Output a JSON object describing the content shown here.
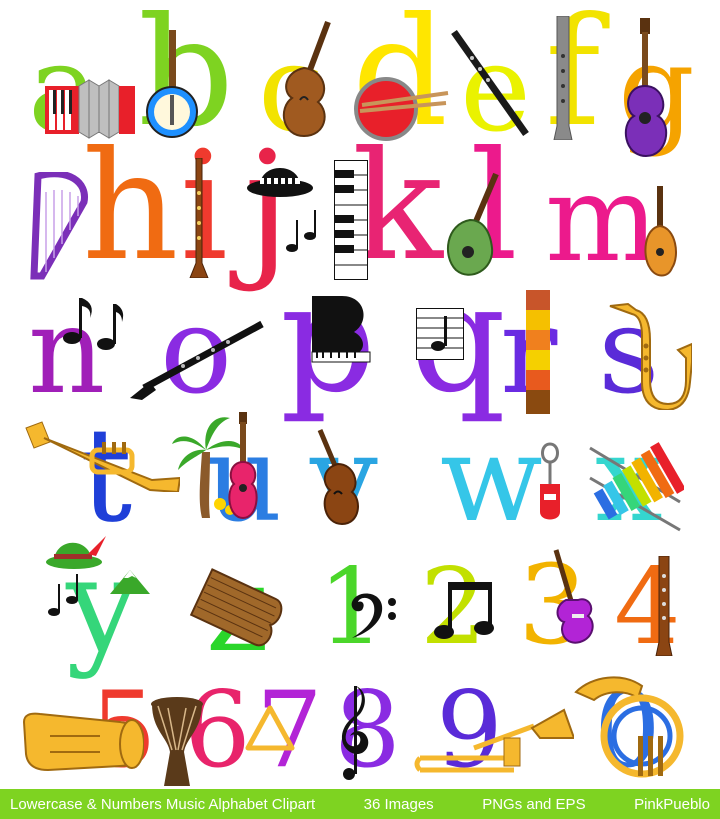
{
  "glyphs": [
    {
      "char": "a",
      "color": "#7ed321"
    },
    {
      "char": "b",
      "color": "#7ed321"
    },
    {
      "char": "c",
      "color": "#f2e300"
    },
    {
      "char": "d",
      "color": "#ffe600"
    },
    {
      "char": "e",
      "color": "#eaf200"
    },
    {
      "char": "f",
      "color": "#f2e300"
    },
    {
      "char": "g",
      "color": "#f5a300"
    },
    {
      "char": "h",
      "color": "#f06b12"
    },
    {
      "char": "i",
      "color": "#ef3a2e"
    },
    {
      "char": "j",
      "color": "#e8244a"
    },
    {
      "char": "k",
      "color": "#e82473"
    },
    {
      "char": "l",
      "color": "#ec1a8c"
    },
    {
      "char": "m",
      "color": "#ec1a8c"
    },
    {
      "char": "n",
      "color": "#a01fb8"
    },
    {
      "char": "o",
      "color": "#8a2be2"
    },
    {
      "char": "p",
      "color": "#8a2be2"
    },
    {
      "char": "q",
      "color": "#8a2be2"
    },
    {
      "char": "r",
      "color": "#6a2be2"
    },
    {
      "char": "s",
      "color": "#5a2bd8"
    },
    {
      "char": "t",
      "color": "#1f3fd8"
    },
    {
      "char": "u",
      "color": "#2b7de2"
    },
    {
      "char": "v",
      "color": "#2aa5e2"
    },
    {
      "char": "w",
      "color": "#35c6e8"
    },
    {
      "char": "x",
      "color": "#35d6cf"
    },
    {
      "char": "y",
      "color": "#35d67a"
    },
    {
      "char": "z",
      "color": "#2ad62a"
    },
    {
      "char": "1",
      "color": "#4bd62a"
    },
    {
      "char": "2",
      "color": "#c2e000"
    },
    {
      "char": "3",
      "color": "#f2b300"
    },
    {
      "char": "4",
      "color": "#f06b12"
    },
    {
      "char": "5",
      "color": "#ef3a2e"
    },
    {
      "char": "6",
      "color": "#e8246b"
    },
    {
      "char": "7",
      "color": "#b224d6"
    },
    {
      "char": "8",
      "color": "#8a2be2"
    },
    {
      "char": "9",
      "color": "#5a2bd8"
    },
    {
      "char": "0",
      "color": "#2b6ee2"
    }
  ],
  "footer": {
    "title": "Lowercase & Numbers Music Alphabet Clipart",
    "count": "36 Images",
    "formats": "PNGs and EPS",
    "brand": "PinkPueblo",
    "background": "#7ed321"
  },
  "instruments": [
    "accordion-icon",
    "banjo-icon",
    "violin-icon",
    "drum-icon",
    "flute-icon",
    "recorder-icon",
    "guitar-icon",
    "harp-icon",
    "fedora-hat-icon",
    "piano-keys-icon",
    "mandolin-icon",
    "music-notes-icon",
    "clarinet-icon",
    "grand-piano-icon",
    "sheet-music-icon",
    "rainstick-icon",
    "saxophone-icon",
    "trumpet-icon",
    "palm-tree-icon",
    "ukulele-icon",
    "whistle-icon",
    "xylophone-icon",
    "alpine-hat-icon",
    "zither-icon",
    "bass-clef-icon",
    "eighth-notes-icon",
    "electric-guitar-icon",
    "tuba-icon",
    "djembe-icon",
    "triangle-icon",
    "treble-clef-icon",
    "trombone-icon",
    "french-horn-icon"
  ]
}
